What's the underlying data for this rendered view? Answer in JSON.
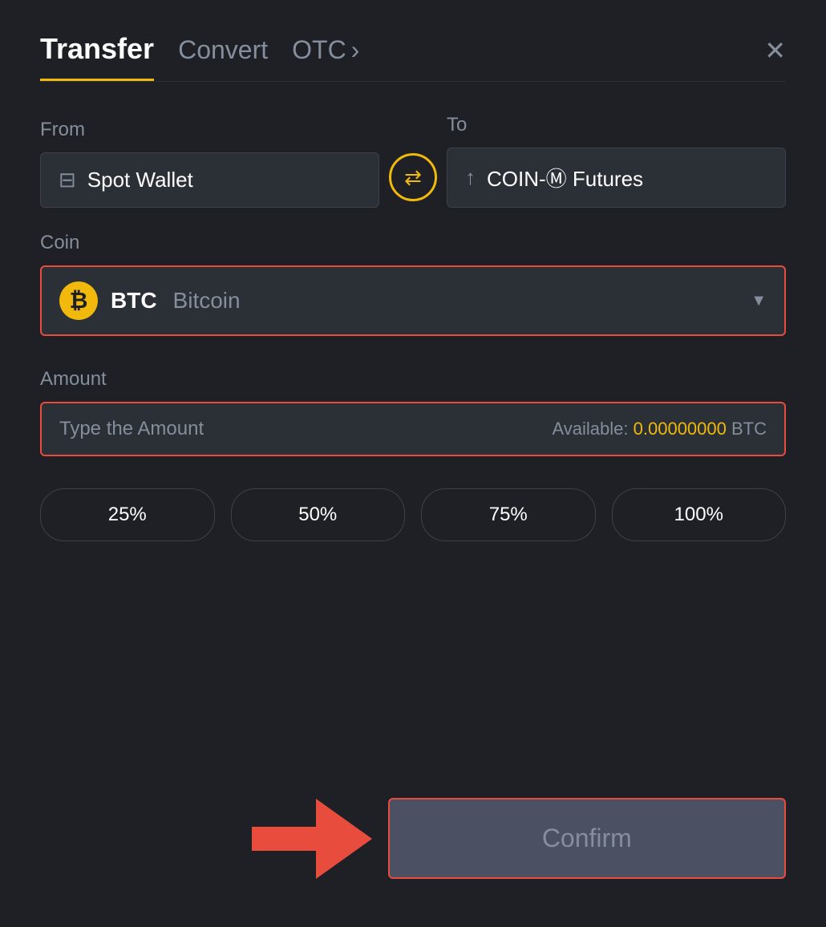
{
  "header": {
    "tab_transfer": "Transfer",
    "tab_convert": "Convert",
    "tab_otc": "OTC",
    "tab_otc_arrow": "›",
    "close_label": "✕"
  },
  "from": {
    "label": "From",
    "wallet_name": "Spot Wallet"
  },
  "to": {
    "label": "To",
    "wallet_name": "COIN-Ⓜ Futures"
  },
  "coin": {
    "label": "Coin",
    "symbol": "BTC",
    "name": "Bitcoin"
  },
  "amount": {
    "label": "Amount",
    "placeholder": "Type the Amount",
    "available_label": "Available:",
    "available_value": "0.00000000",
    "available_unit": "BTC"
  },
  "percentages": [
    "25%",
    "50%",
    "75%",
    "100%"
  ],
  "confirm": {
    "label": "Confirm"
  }
}
